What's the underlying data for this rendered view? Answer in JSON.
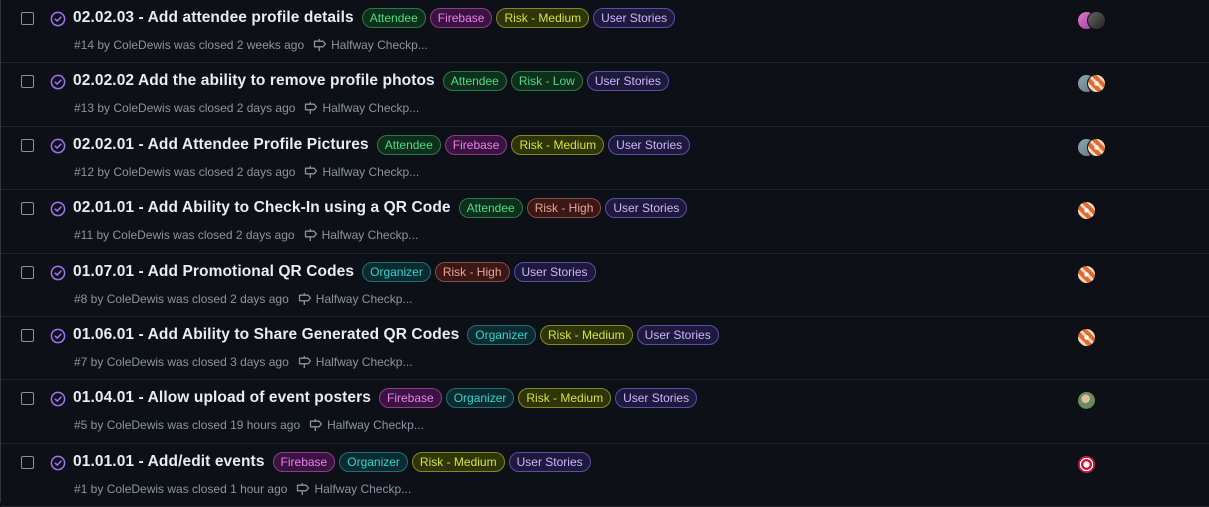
{
  "issues": [
    {
      "title": "02.02.03 - Add attendee profile details",
      "labels": [
        {
          "text": "Attendee",
          "kind": "attendee"
        },
        {
          "text": "Firebase",
          "kind": "firebase"
        },
        {
          "text": "Risk - Medium",
          "kind": "risk-medium"
        },
        {
          "text": "User Stories",
          "kind": "user-stories"
        }
      ],
      "meta": "#14 by ColeDewis was closed 2 weeks ago",
      "milestone": "Halfway Checkp...",
      "avatars": [
        "pink",
        "dark"
      ]
    },
    {
      "title": "02.02.02 Add the ability to remove profile photos",
      "labels": [
        {
          "text": "Attendee",
          "kind": "attendee"
        },
        {
          "text": "Risk - Low",
          "kind": "risk-low"
        },
        {
          "text": "User Stories",
          "kind": "user-stories"
        }
      ],
      "meta": "#13 by ColeDewis was closed 2 days ago",
      "milestone": "Halfway Checkp...",
      "avatars": [
        "gray",
        "orange"
      ]
    },
    {
      "title": "02.02.01 - Add Attendee Profile Pictures",
      "labels": [
        {
          "text": "Attendee",
          "kind": "attendee"
        },
        {
          "text": "Firebase",
          "kind": "firebase"
        },
        {
          "text": "Risk - Medium",
          "kind": "risk-medium"
        },
        {
          "text": "User Stories",
          "kind": "user-stories"
        }
      ],
      "meta": "#12 by ColeDewis was closed 2 days ago",
      "milestone": "Halfway Checkp...",
      "avatars": [
        "gray",
        "orange"
      ]
    },
    {
      "title": "02.01.01 - Add Ability to Check-In using a QR Code",
      "labels": [
        {
          "text": "Attendee",
          "kind": "attendee"
        },
        {
          "text": "Risk - High",
          "kind": "risk-high"
        },
        {
          "text": "User Stories",
          "kind": "user-stories"
        }
      ],
      "meta": "#11 by ColeDewis was closed 2 days ago",
      "milestone": "Halfway Checkp...",
      "avatars": [
        "orange"
      ]
    },
    {
      "title": "01.07.01 - Add Promotional QR Codes",
      "labels": [
        {
          "text": "Organizer",
          "kind": "organizer"
        },
        {
          "text": "Risk - High",
          "kind": "risk-high"
        },
        {
          "text": "User Stories",
          "kind": "user-stories"
        }
      ],
      "meta": "#8 by ColeDewis was closed 2 days ago",
      "milestone": "Halfway Checkp...",
      "avatars": [
        "orange"
      ]
    },
    {
      "title": "01.06.01 - Add Ability to Share Generated QR Codes",
      "labels": [
        {
          "text": "Organizer",
          "kind": "organizer"
        },
        {
          "text": "Risk - Medium",
          "kind": "risk-medium"
        },
        {
          "text": "User Stories",
          "kind": "user-stories"
        }
      ],
      "meta": "#7 by ColeDewis was closed 3 days ago",
      "milestone": "Halfway Checkp...",
      "avatars": [
        "orange"
      ]
    },
    {
      "title": "01.04.01 - Allow upload of event posters",
      "labels": [
        {
          "text": "Firebase",
          "kind": "firebase"
        },
        {
          "text": "Organizer",
          "kind": "organizer"
        },
        {
          "text": "Risk - Medium",
          "kind": "risk-medium"
        },
        {
          "text": "User Stories",
          "kind": "user-stories"
        }
      ],
      "meta": "#5 by ColeDewis was closed 19 hours ago",
      "milestone": "Halfway Checkp...",
      "avatars": [
        "photo"
      ]
    },
    {
      "title": "01.01.01 - Add/edit events",
      "labels": [
        {
          "text": "Firebase",
          "kind": "firebase"
        },
        {
          "text": "Organizer",
          "kind": "organizer"
        },
        {
          "text": "Risk - Medium",
          "kind": "risk-medium"
        },
        {
          "text": "User Stories",
          "kind": "user-stories"
        }
      ],
      "meta": "#1 by ColeDewis was closed 1 hour ago",
      "milestone": "Halfway Checkp...",
      "avatars": [
        "red"
      ]
    }
  ],
  "colors": {
    "background": "#0d1117",
    "closed_icon": "#a371f7",
    "meta_text": "#8b949e"
  },
  "icons": {
    "closed": "check-circle-icon",
    "milestone": "milestone-icon"
  }
}
